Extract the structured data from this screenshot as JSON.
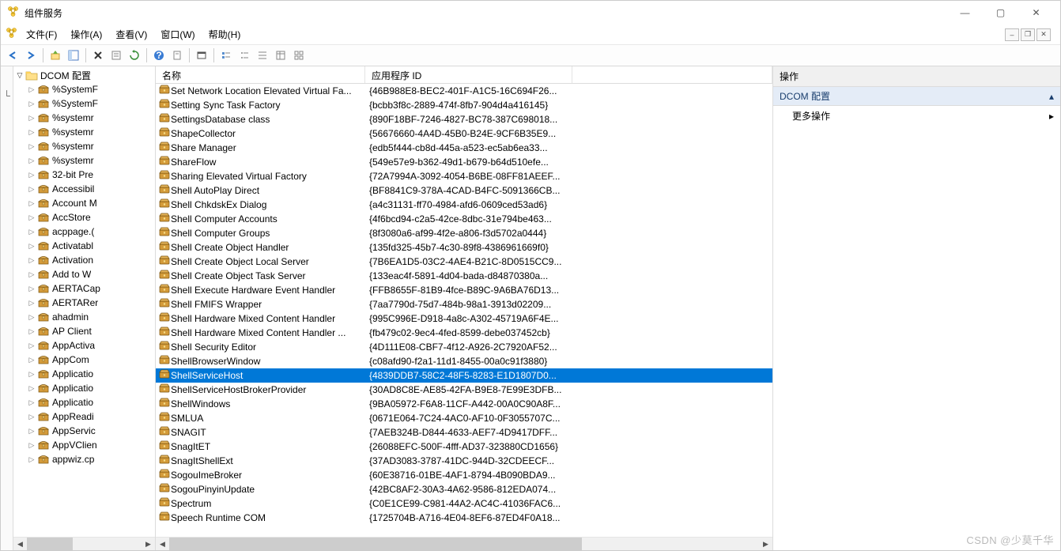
{
  "title": "组件服务",
  "menus": [
    "文件(F)",
    "操作(A)",
    "查看(V)",
    "窗口(W)",
    "帮助(H)"
  ],
  "tree": {
    "root_label": "DCOM 配置",
    "items": [
      "%SystemF",
      "%SystemF",
      "%systemr",
      "%systemr",
      "%systemr",
      "%systemr",
      "32-bit Pre",
      "Accessibil",
      "Account M",
      "AccStore",
      "acppage.(",
      "Activatabl",
      "Activation",
      "Add to W",
      "AERTACap",
      "AERTARer",
      "ahadmin",
      "AP Client",
      "AppActiva",
      "AppCom",
      "Applicatio",
      "Applicatio",
      "Applicatio",
      "AppReadi",
      "AppServic",
      "AppVClien",
      "appwiz.cp"
    ]
  },
  "list": {
    "col1": "名称",
    "col2": "应用程序 ID",
    "rows": [
      {
        "n": "Set Network Location Elevated Virtual Fa...",
        "id": "{46B988E8-BEC2-401F-A1C5-16C694F26...",
        "sel": false
      },
      {
        "n": "Setting Sync Task Factory",
        "id": "{bcbb3f8c-2889-474f-8fb7-904d4a416145}",
        "sel": false
      },
      {
        "n": "SettingsDatabase class",
        "id": "{890F18BF-7246-4827-BC78-387C698018...",
        "sel": false
      },
      {
        "n": "ShapeCollector",
        "id": "{56676660-4A4D-45B0-B24E-9CF6B35E9...",
        "sel": false
      },
      {
        "n": "Share Manager",
        "id": "{edb5f444-cb8d-445a-a523-ec5ab6ea33...",
        "sel": false
      },
      {
        "n": "ShareFlow",
        "id": "{549e57e9-b362-49d1-b679-b64d510efe...",
        "sel": false
      },
      {
        "n": "Sharing Elevated Virtual Factory",
        "id": "{72A7994A-3092-4054-B6BE-08FF81AEEF...",
        "sel": false
      },
      {
        "n": "Shell AutoPlay Direct",
        "id": "{BF8841C9-378A-4CAD-B4FC-5091366CB...",
        "sel": false
      },
      {
        "n": "Shell ChkdskEx Dialog",
        "id": "{a4c31131-ff70-4984-afd6-0609ced53ad6}",
        "sel": false
      },
      {
        "n": "Shell Computer Accounts",
        "id": "{4f6bcd94-c2a5-42ce-8dbc-31e794be463...",
        "sel": false
      },
      {
        "n": "Shell Computer Groups",
        "id": "{8f3080a6-af99-4f2e-a806-f3d5702a0444}",
        "sel": false
      },
      {
        "n": "Shell Create Object Handler",
        "id": "{135fd325-45b7-4c30-89f8-4386961669f0}",
        "sel": false
      },
      {
        "n": "Shell Create Object Local Server",
        "id": "{7B6EA1D5-03C2-4AE4-B21C-8D0515CC9...",
        "sel": false
      },
      {
        "n": "Shell Create Object Task Server",
        "id": "{133eac4f-5891-4d04-bada-d84870380a...",
        "sel": false
      },
      {
        "n": "Shell Execute Hardware Event Handler",
        "id": "{FFB8655F-81B9-4fce-B89C-9A6BA76D13...",
        "sel": false
      },
      {
        "n": "Shell FMIFS Wrapper",
        "id": "{7aa7790d-75d7-484b-98a1-3913d02209...",
        "sel": false
      },
      {
        "n": "Shell Hardware Mixed Content Handler",
        "id": "{995C996E-D918-4a8c-A302-45719A6F4E...",
        "sel": false
      },
      {
        "n": "Shell Hardware Mixed Content Handler ...",
        "id": "{fb479c02-9ec4-4fed-8599-debe037452cb}",
        "sel": false
      },
      {
        "n": "Shell Security Editor",
        "id": "{4D111E08-CBF7-4f12-A926-2C7920AF52...",
        "sel": false
      },
      {
        "n": "ShellBrowserWindow",
        "id": "{c08afd90-f2a1-11d1-8455-00a0c91f3880}",
        "sel": false
      },
      {
        "n": "ShellServiceHost",
        "id": "{4839DDB7-58C2-48F5-8283-E1D1807D0...",
        "sel": true
      },
      {
        "n": "ShellServiceHostBrokerProvider",
        "id": "{30AD8C8E-AE85-42FA-B9E8-7E99E3DFB...",
        "sel": false
      },
      {
        "n": "ShellWindows",
        "id": "{9BA05972-F6A8-11CF-A442-00A0C90A8F...",
        "sel": false
      },
      {
        "n": "SMLUA",
        "id": "{0671E064-7C24-4AC0-AF10-0F3055707C...",
        "sel": false
      },
      {
        "n": "SNAGIT",
        "id": "{7AEB324B-D844-4633-AEF7-4D9417DFF...",
        "sel": false
      },
      {
        "n": "SnagItET",
        "id": "{26088EFC-500F-4fff-AD37-323880CD1656}",
        "sel": false
      },
      {
        "n": "SnagItShellExt",
        "id": "{37AD3083-3787-41DC-944D-32CDEECF...",
        "sel": false
      },
      {
        "n": "SogouImeBroker",
        "id": "{60E38716-01BE-4AF1-8794-4B090BDA9...",
        "sel": false
      },
      {
        "n": "SogouPinyinUpdate",
        "id": "{42BC8AF2-30A3-4A62-9586-812EDA074...",
        "sel": false
      },
      {
        "n": "Spectrum",
        "id": "{C0E1CE99-C981-44A2-AC4C-41036FAC6...",
        "sel": false
      },
      {
        "n": "Speech Runtime COM",
        "id": "{1725704B-A716-4E04-8EF6-87ED4F0A18...",
        "sel": false
      }
    ]
  },
  "actions": {
    "header": "操作",
    "section": "DCOM 配置",
    "more": "更多操作"
  },
  "watermark": "CSDN @少莫千华"
}
